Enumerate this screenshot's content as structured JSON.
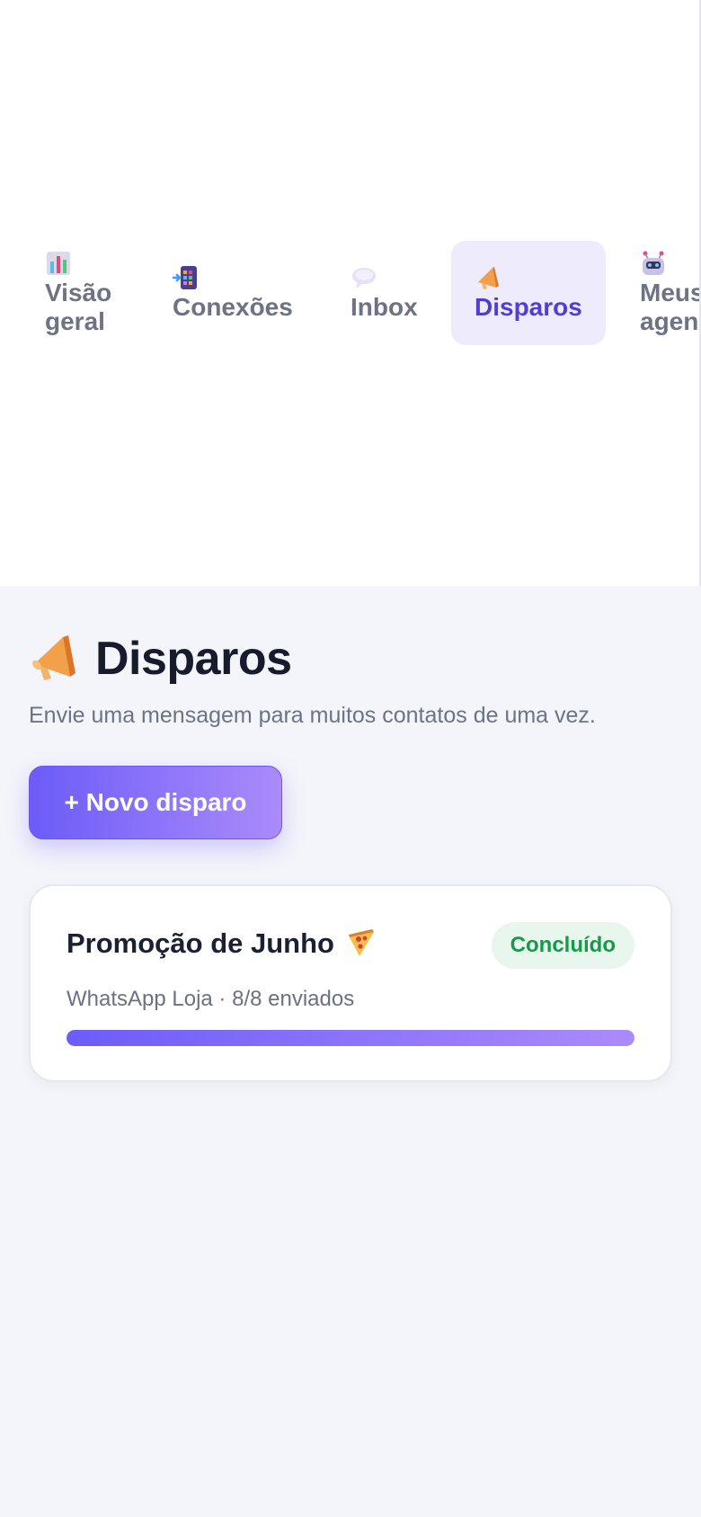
{
  "nav": {
    "items": [
      {
        "id": "visao-geral",
        "label_line1": "Visão",
        "label_line2": "geral",
        "icon": "bar-chart-icon",
        "active": false
      },
      {
        "id": "conexoes",
        "label": "Conexões",
        "icon": "phone-link-icon",
        "active": false
      },
      {
        "id": "inbox",
        "label": "Inbox",
        "icon": "speech-bubble-icon",
        "active": false
      },
      {
        "id": "disparos",
        "label": "Disparos",
        "icon": "megaphone-icon",
        "active": true
      },
      {
        "id": "meus-agentes",
        "label_line1": "Meus",
        "label_line2": "agen",
        "icon": "robot-icon",
        "active": false
      }
    ]
  },
  "main": {
    "title_icon": "megaphone-icon",
    "title": "Disparos",
    "subtitle": "Envie uma mensagem para muitos contatos de uma vez.",
    "new_button_label": "+ Novo disparo"
  },
  "campaigns": [
    {
      "title": "Promoção de Junho",
      "emoji_icon": "pizza-icon",
      "status": "Concluído",
      "meta": "WhatsApp Loja · 8/8 enviados",
      "sent": 8,
      "total": 8
    }
  ],
  "colors": {
    "accent": "#6c5cf8",
    "accent_light": "#ab8bfb",
    "active_nav_bg": "#eeebfd",
    "active_nav_text": "#4f3fd0",
    "success_text": "#17994a",
    "success_bg": "#e8f6ee",
    "page_bg": "#f4f5fa"
  }
}
